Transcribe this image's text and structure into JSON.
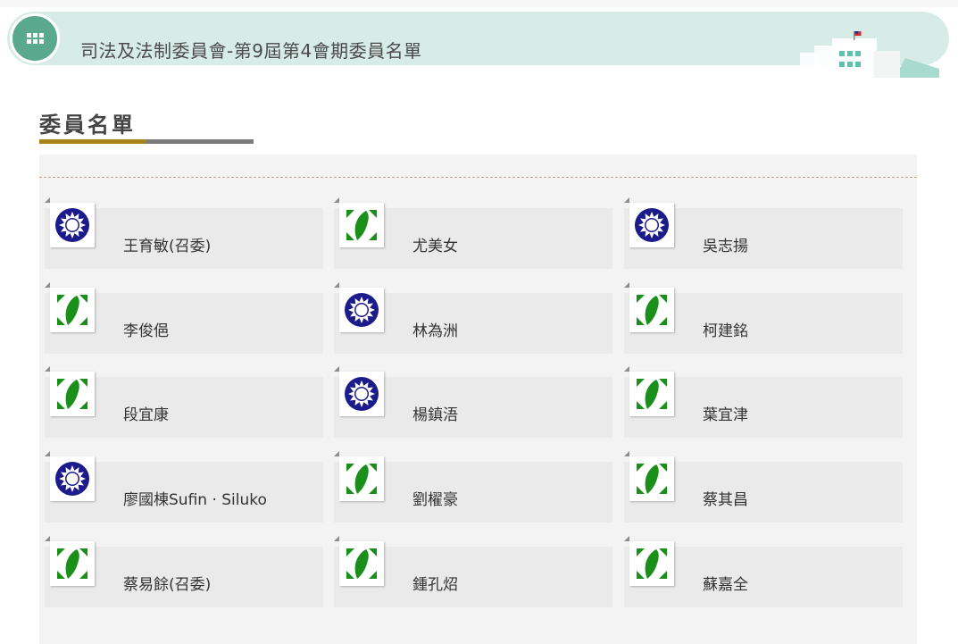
{
  "header": {
    "title": "司法及法制委員會-第9屆第4會期委員名單",
    "menu_icon": "grid-icon",
    "decoration_icon": "building-icon",
    "accent_color": "#5aa98e"
  },
  "section": {
    "title": "委員名單"
  },
  "party_colors": {
    "kmt": "#1b1b8c",
    "dpp": "#1a8f1a"
  },
  "members": [
    {
      "name": "王育敏(召委)",
      "party": "kmt"
    },
    {
      "name": "尤美女",
      "party": "dpp"
    },
    {
      "name": "吳志揚",
      "party": "kmt"
    },
    {
      "name": "李俊俋",
      "party": "dpp"
    },
    {
      "name": "林為洲",
      "party": "kmt"
    },
    {
      "name": "柯建銘",
      "party": "dpp"
    },
    {
      "name": "段宜康",
      "party": "dpp"
    },
    {
      "name": "楊鎮浯",
      "party": "kmt"
    },
    {
      "name": "葉宜津",
      "party": "dpp"
    },
    {
      "name": "廖國棟Sufin · Siluko",
      "party": "kmt"
    },
    {
      "name": "劉櫂豪",
      "party": "dpp"
    },
    {
      "name": "蔡其昌",
      "party": "dpp"
    },
    {
      "name": "蔡易餘(召委)",
      "party": "dpp"
    },
    {
      "name": "鍾孔炤",
      "party": "dpp"
    },
    {
      "name": "蘇嘉全",
      "party": "dpp"
    }
  ]
}
